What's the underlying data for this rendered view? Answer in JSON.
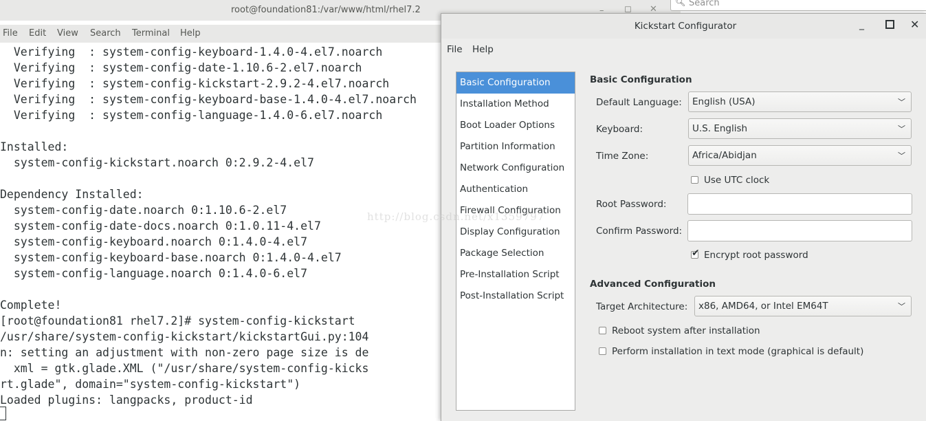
{
  "terminal": {
    "title": "root@foundation81:/var/www/html/rhel7.2",
    "menu": [
      "File",
      "Edit",
      "View",
      "Search",
      "Terminal",
      "Help"
    ],
    "lines": [
      "  Verifying  : system-config-keyboard-1.4.0-4.el7.noarch",
      "  Verifying  : system-config-date-1.10.6-2.el7.noarch",
      "  Verifying  : system-config-kickstart-2.9.2-4.el7.noarch",
      "  Verifying  : system-config-keyboard-base-1.4.0-4.el7.noarch",
      "  Verifying  : system-config-language-1.4.0-6.el7.noarch",
      "",
      "Installed:",
      "  system-config-kickstart.noarch 0:2.9.2-4.el7",
      "",
      "Dependency Installed:",
      "  system-config-date.noarch 0:1.10.6-2.el7",
      "  system-config-date-docs.noarch 0:1.0.11-4.el7",
      "  system-config-keyboard.noarch 0:1.4.0-4.el7",
      "  system-config-keyboard-base.noarch 0:1.4.0-4.el7",
      "  system-config-language.noarch 0:1.4.0-6.el7",
      "",
      "Complete!",
      "[root@foundation81 rhel7.2]# system-config-kickstart",
      "/usr/share/system-config-kickstart/kickstartGui.py:104",
      "n: setting an adjustment with non-zero page size is de",
      "  xml = gtk.glade.XML (\"/usr/share/system-config-kicks",
      "rt.glade\", domain=\"system-config-kickstart\")",
      "Loaded plugins: langpacks, product-id"
    ]
  },
  "background_search": {
    "placeholder": "Search"
  },
  "watermark": "http://blog.csdn.net/x1359797",
  "kickstart": {
    "title": "Kickstart Configurator",
    "menu": [
      "File",
      "Help"
    ],
    "nav": [
      "Basic Configuration",
      "Installation Method",
      "Boot Loader Options",
      "Partition Information",
      "Network Configuration",
      "Authentication",
      "Firewall Configuration",
      "Display Configuration",
      "Package Selection",
      "Pre-Installation Script",
      "Post-Installation Script"
    ],
    "selected_nav": "Basic Configuration",
    "basic": {
      "section_title": "Basic Configuration",
      "default_language_label": "Default Language:",
      "default_language_value": "English (USA)",
      "keyboard_label": "Keyboard:",
      "keyboard_value": "U.S. English",
      "timezone_label": "Time Zone:",
      "timezone_value": "Africa/Abidjan",
      "utc_label": "Use UTC clock",
      "utc_checked": false,
      "root_password_label": "Root Password:",
      "root_password_value": "",
      "confirm_password_label": "Confirm Password:",
      "confirm_password_value": "",
      "encrypt_label": "Encrypt root password",
      "encrypt_checked": true
    },
    "advanced": {
      "section_title": "Advanced Configuration",
      "target_arch_label": "Target Architecture:",
      "target_arch_value": "x86, AMD64, or Intel EM64T",
      "reboot_label": "Reboot system after installation",
      "reboot_checked": false,
      "textmode_label": "Perform installation in text mode (graphical is default)",
      "textmode_checked": false
    }
  },
  "colors": {
    "selection": "#4a90d9",
    "window_bg": "#ededec",
    "terminal_text": "#2e3436"
  }
}
